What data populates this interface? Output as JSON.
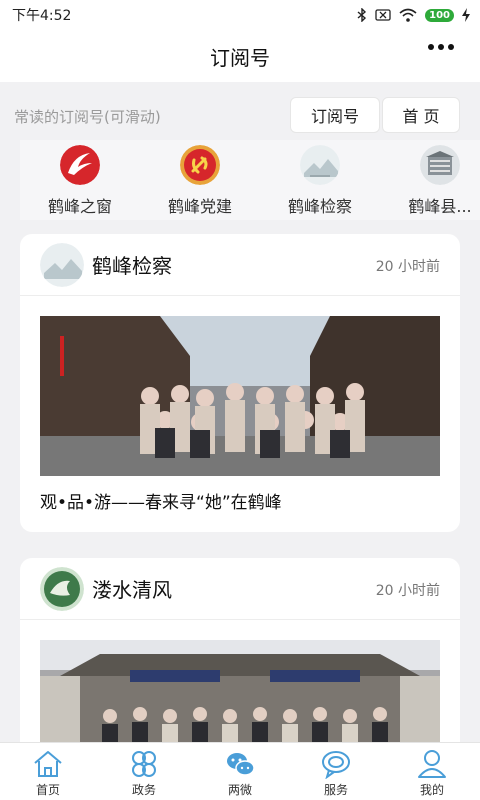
{
  "status": {
    "time": "下午4:52",
    "battery": "100"
  },
  "nav": {
    "title": "订阅号"
  },
  "subscribe_header": {
    "hint": "常读的订阅号(可滑动)",
    "subscribe_button": "订阅号",
    "home_button": "首 页"
  },
  "accounts": [
    {
      "name": "鹤峰之窗"
    },
    {
      "name": "鹤峰党建"
    },
    {
      "name": "鹤峰检察"
    },
    {
      "name": "鹤峰县..."
    }
  ],
  "articles": [
    {
      "account": "鹤峰检察",
      "time": "20 小时前",
      "title": "观•品•游——春来寻“她”在鹤峰"
    },
    {
      "account": "溇水清风",
      "time": "20 小时前",
      "title": ""
    }
  ],
  "tabs": [
    {
      "label": "首页"
    },
    {
      "label": "政务"
    },
    {
      "label": "两微"
    },
    {
      "label": "服务"
    },
    {
      "label": "我的"
    }
  ],
  "colors": {
    "tab_accent": "#4a9ed8",
    "brand_red": "#d6262b"
  }
}
